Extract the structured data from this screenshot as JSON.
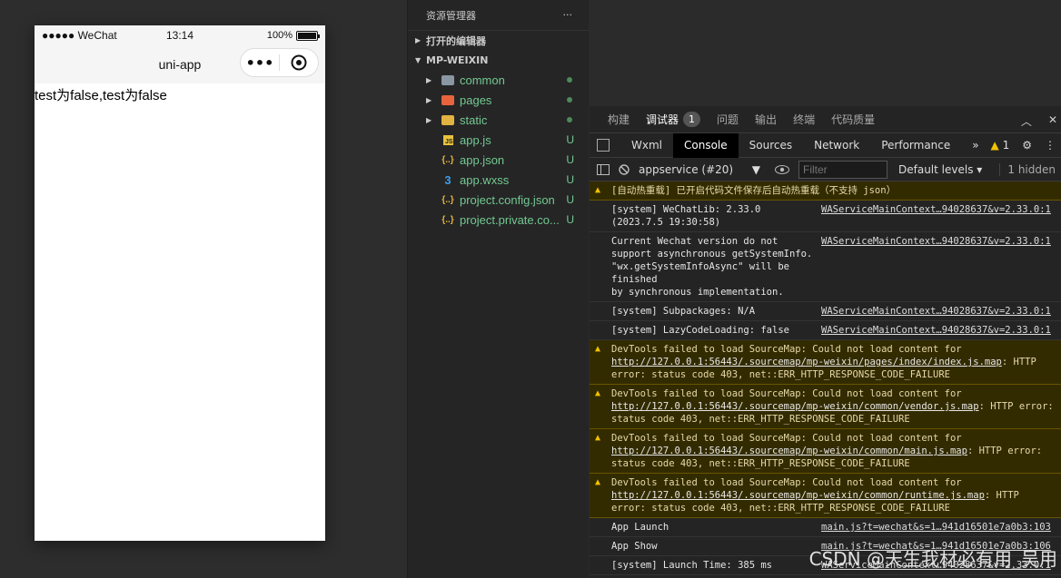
{
  "simulator": {
    "status": {
      "carrier": "●●●●● WeChat",
      "time": "13:14",
      "battery": "100%",
      "battery_level": 1.0
    },
    "nav_title": "uni-app",
    "content_text": "test为false,test为false"
  },
  "explorer": {
    "title": "资源管理器",
    "menu": "···",
    "open_editors": "打开的编辑器",
    "project": "MP-WEIXIN",
    "files": [
      {
        "name": "common",
        "kind": "folder",
        "status": "dot"
      },
      {
        "name": "pages",
        "kind": "folder",
        "status": "dot"
      },
      {
        "name": "static",
        "kind": "folder",
        "status": "dot"
      },
      {
        "name": "app.js",
        "kind": "js",
        "status": "U"
      },
      {
        "name": "app.json",
        "kind": "json",
        "status": "U"
      },
      {
        "name": "app.wxss",
        "kind": "css",
        "status": "U"
      },
      {
        "name": "project.config.json",
        "kind": "json",
        "status": "U"
      },
      {
        "name": "project.private.co...",
        "kind": "json",
        "status": "U"
      }
    ]
  },
  "devtools": {
    "tabs": [
      {
        "label": "构建"
      },
      {
        "label": "调试器",
        "badge": "1"
      },
      {
        "label": "问题"
      },
      {
        "label": "输出"
      },
      {
        "label": "终端"
      },
      {
        "label": "代码质量"
      }
    ],
    "panels": [
      "Wxml",
      "Console",
      "Sources",
      "Network",
      "Performance"
    ],
    "active_panel": "Console",
    "panel_more": "»",
    "warn_count": "1",
    "context": "appservice (#20)",
    "filter_placeholder": "Filter",
    "levels": "Default levels ▾",
    "hidden": "1 hidden",
    "logs": [
      {
        "type": "warn",
        "msg": "[自动热重载] 已开启代码文件保存后自动热重载（不支持 json）",
        "src": ""
      },
      {
        "type": "info",
        "msg": "[system] WeChatLib: 2.33.0\n(2023.7.5 19:30:58)",
        "src": "WAServiceMainContext…94028637&v=2.33.0:1"
      },
      {
        "type": "info",
        "msg": "Current Wechat version do not\nsupport asynchronous getSystemInfo. \"wx.getSystemInfoAsync\" will be finished\nby synchronous implementation.",
        "src": "WAServiceMainContext…94028637&v=2.33.0:1"
      },
      {
        "type": "info",
        "msg": "[system] Subpackages: N/A",
        "src": "WAServiceMainContext…94028637&v=2.33.0:1"
      },
      {
        "type": "info",
        "msg": "[system] LazyCodeLoading: false",
        "src": "WAServiceMainContext…94028637&v=2.33.0:1"
      },
      {
        "type": "warn",
        "msg": "DevTools failed to load SourceMap: Could not load content for ",
        "link": "http://127.0.0.1:56443/.sourcemap/mp-weixin/pages/index/index.js.map",
        "tail": ": HTTP error: status code 403, net::ERR_HTTP_RESPONSE_CODE_FAILURE",
        "src": ""
      },
      {
        "type": "warn",
        "msg": "DevTools failed to load SourceMap: Could not load content for ",
        "link": "http://127.0.0.1:56443/.sourcemap/mp-weixin/common/vendor.js.map",
        "tail": ": HTTP error: status code 403, net::ERR_HTTP_RESPONSE_CODE_FAILURE",
        "src": ""
      },
      {
        "type": "warn",
        "msg": "DevTools failed to load SourceMap: Could not load content for ",
        "link": "http://127.0.0.1:56443/.sourcemap/mp-weixin/common/main.js.map",
        "tail": ": HTTP error: status code 403, net::ERR_HTTP_RESPONSE_CODE_FAILURE",
        "src": ""
      },
      {
        "type": "warn",
        "msg": "DevTools failed to load SourceMap: Could not load content for ",
        "link": "http://127.0.0.1:56443/.sourcemap/mp-weixin/common/runtime.js.map",
        "tail": ": HTTP error: status code 403, net::ERR_HTTP_RESPONSE_CODE_FAILURE",
        "src": ""
      },
      {
        "type": "info",
        "msg": "App Launch",
        "src": "main.js?t=wechat&s=1…941d16501e7a0b3:103"
      },
      {
        "type": "info",
        "msg": "App Show",
        "src": "main.js?t=wechat&s=1…941d16501e7a0b3:106"
      },
      {
        "type": "info",
        "msg": "[system] Launch Time: 385 ms",
        "src": "WAServiceMainContext…94028637&v=2.33.0:1"
      }
    ],
    "prompt": "›"
  },
  "watermark": "CSDN @天生我材必有用_吴用",
  "colors": {
    "accent": "#73c991",
    "warning": "#f2c200",
    "link_blue": "#4ea4ff"
  }
}
